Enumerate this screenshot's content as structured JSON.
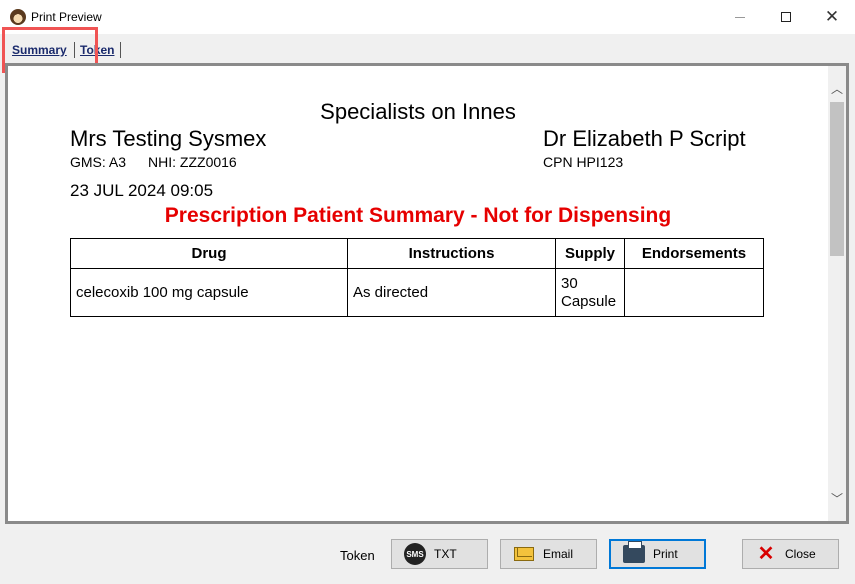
{
  "window": {
    "title": "Print Preview",
    "minimize_glyph": "",
    "maximize_glyph": "",
    "close_glyph": "✕"
  },
  "tabs": [
    {
      "label": "Summary"
    },
    {
      "label": "Token"
    }
  ],
  "document": {
    "clinic": "Specialists on Innes",
    "patient_name": "Mrs Testing Sysmex",
    "gms": "GMS: A3",
    "nhi": "NHI: ZZZ0016",
    "doctor_name": "Dr Elizabeth P Script",
    "doctor_cpn": "CPN HPI123",
    "date": "23 JUL 2024 09:05",
    "notice": "Prescription Patient Summary - Not for Dispensing",
    "notice_color": "#e60000",
    "table": {
      "headers": [
        "Drug",
        "Instructions",
        "Supply",
        "Endorsements"
      ],
      "rows": [
        {
          "drug": "celecoxib 100 mg capsule",
          "instructions": "As directed",
          "supply_qty": "30",
          "supply_unit": "Capsule",
          "endorsements": ""
        }
      ]
    }
  },
  "footer": {
    "token_label": "Token",
    "txt_label": "TXT",
    "email_label": "Email",
    "print_label": "Print",
    "close_label": "Close",
    "sms_glyph": "SMS"
  },
  "colors": {
    "highlight": "#f05454",
    "tab_text": "#1a2a6c",
    "print_focus": "#0078d7"
  }
}
